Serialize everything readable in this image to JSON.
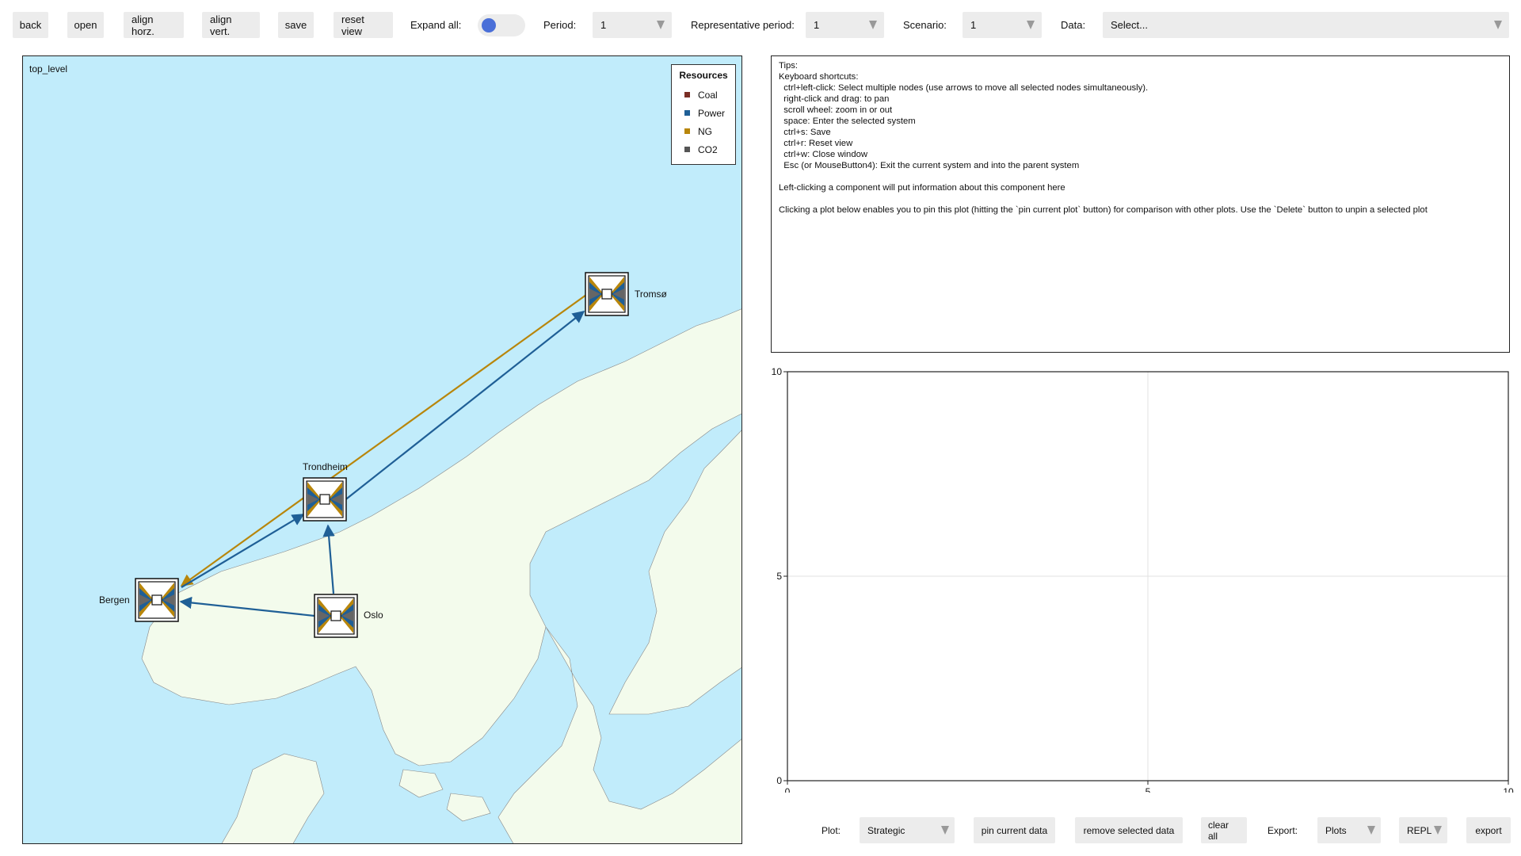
{
  "toolbar": {
    "back": "back",
    "open": "open",
    "align_horz": "align horz.",
    "align_vert": "align vert.",
    "save": "save",
    "reset_view": "reset view",
    "expand_all_label": "Expand all:",
    "expand_all_on": false,
    "period_label": "Period:",
    "period_value": "1",
    "rep_period_label": "Representative period:",
    "rep_period_value": "1",
    "scenario_label": "Scenario:",
    "scenario_value": "1",
    "data_label": "Data:",
    "data_value": "Select..."
  },
  "map": {
    "title": "top_level",
    "legend_title": "Resources",
    "resources": [
      {
        "name": "Coal",
        "color": "#7a2e25"
      },
      {
        "name": "Power",
        "color": "#1f5f96"
      },
      {
        "name": "NG",
        "color": "#b8860b"
      },
      {
        "name": "CO2",
        "color": "#555555"
      }
    ],
    "nodes": [
      "Tromsø",
      "Trondheim",
      "Bergen",
      "Oslo"
    ],
    "connections": [
      {
        "from": "Oslo",
        "to": "Bergen",
        "resource": "Power"
      },
      {
        "from": "Oslo",
        "to": "Trondheim",
        "resource": "Power"
      },
      {
        "from": "Bergen",
        "to": "Trondheim",
        "resource": "Power"
      },
      {
        "from": "Trondheim",
        "to": "Tromsø",
        "resource": "Power"
      },
      {
        "from": "Tromsø",
        "to": "Bergen",
        "resource": "NG"
      }
    ]
  },
  "info": {
    "lines": [
      "Tips:",
      "Keyboard shortcuts:",
      "  ctrl+left-click: Select multiple nodes (use arrows to move all selected nodes simultaneously).",
      "  right-click and drag: to pan",
      "  scroll wheel: zoom in or out",
      "  space: Enter the selected system",
      "  ctrl+s: Save",
      "  ctrl+r: Reset view",
      "  ctrl+w: Close window",
      "  Esc (or MouseButton4): Exit the current system and into the parent system",
      "",
      "Left-clicking a component will put information about this component here",
      "",
      "Clicking a plot below enables you to pin this plot (hitting the `pin current plot` button) for comparison with other plots. Use the `Delete` button to unpin a selected plot"
    ]
  },
  "chart_data": {
    "type": "line",
    "title": "",
    "xlabel": "",
    "ylabel": "",
    "xlim": [
      0,
      10
    ],
    "ylim": [
      0,
      10
    ],
    "x_ticks": [
      "0",
      "5",
      "10"
    ],
    "y_ticks": [
      "0",
      "5",
      "10"
    ],
    "grid": true,
    "series": []
  },
  "bottom": {
    "plot_label": "Plot:",
    "plot_value": "Strategic",
    "pin_current_data": "pin current data",
    "remove_selected_data": "remove selected data",
    "clear_all": "clear all",
    "export_label": "Export:",
    "export_value": "Plots",
    "repl_value": "REPL",
    "export_button": "export"
  }
}
